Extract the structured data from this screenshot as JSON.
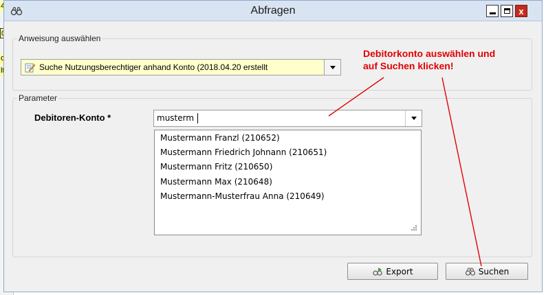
{
  "background": {
    "cells": [
      "4",
      "0",
      "o",
      "lt"
    ]
  },
  "window": {
    "title": "Abfragen",
    "close_label": "x"
  },
  "statement_group": {
    "label": "Anweisung auswählen",
    "selected": "Suche Nutzungsberechtiger anhand Konto (2018.04.20 erstellt"
  },
  "parameter_group": {
    "label": "Parameter",
    "field_label": "Debitoren-Konto *",
    "field_value": "musterm",
    "options": [
      "Mustermann Franzl (210652)",
      "Mustermann Friedrich Johnann (210651)",
      "Mustermann Fritz (210650)",
      "Mustermann Max (210648)",
      "Mustermann-Musterfrau Anna (210649)"
    ]
  },
  "annotation": {
    "line1": "Debitorkonto auswählen und",
    "line2": "auf Suchen klicken!",
    "color": "#e00000"
  },
  "buttons": {
    "export_label": "Export",
    "search_label": "Suchen"
  },
  "colors": {
    "titlebar": "#d9e4f2",
    "statement_bg": "#ffffcc",
    "close": "#c42b1c"
  }
}
